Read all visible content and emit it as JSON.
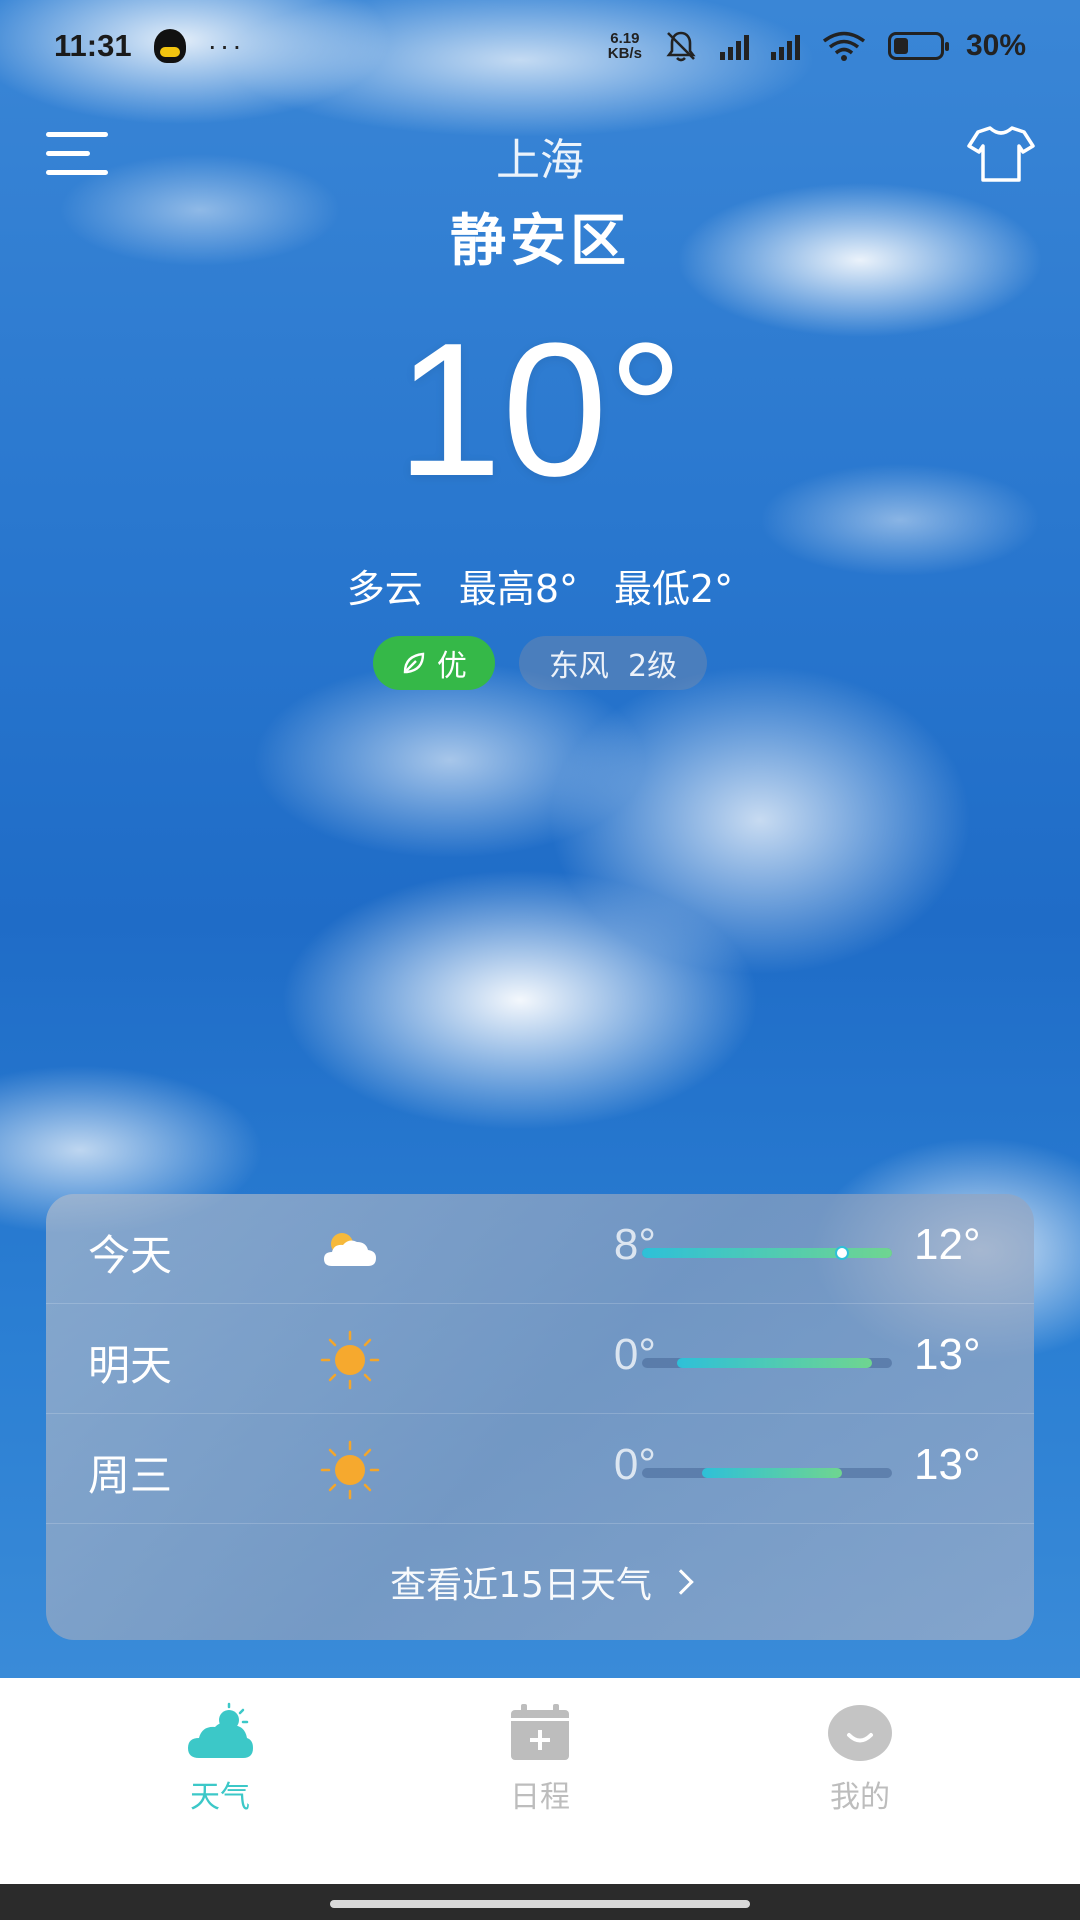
{
  "status_bar": {
    "time": "11:31",
    "more": "···",
    "net_speed_top": "6.19",
    "net_speed_bottom": "KB/s",
    "battery": "30%"
  },
  "header": {
    "city": "上海",
    "district": "静安区"
  },
  "current": {
    "temperature": "10°",
    "condition": "多云",
    "high": "最高8°",
    "low": "最低2°",
    "aqi_label": "优",
    "aqi_color": "#35b848",
    "wind": "东风  2级"
  },
  "forecast": {
    "days": [
      {
        "name": "今天",
        "icon": "partly-cloudy-icon",
        "low": "8°",
        "high": "12°",
        "range_start": 0.0,
        "range_end": 1.0,
        "current_marker": 0.8
      },
      {
        "name": "明天",
        "icon": "sun-icon",
        "low": "0°",
        "high": "13°",
        "range_start": 0.14,
        "range_end": 0.92
      },
      {
        "name": "周三",
        "icon": "sun-icon",
        "low": "0°",
        "high": "13°",
        "range_start": 0.24,
        "range_end": 0.8
      }
    ],
    "more_link": "查看近15日天气"
  },
  "bottom_nav": {
    "items": [
      {
        "label": "天气",
        "icon": "weather-cloud-icon",
        "active": true,
        "color": "#3cc8c8"
      },
      {
        "label": "日程",
        "icon": "calendar-add-icon",
        "active": false,
        "color": "#bdbdbd"
      },
      {
        "label": "我的",
        "icon": "profile-smile-icon",
        "active": false,
        "color": "#bdbdbd"
      }
    ]
  }
}
